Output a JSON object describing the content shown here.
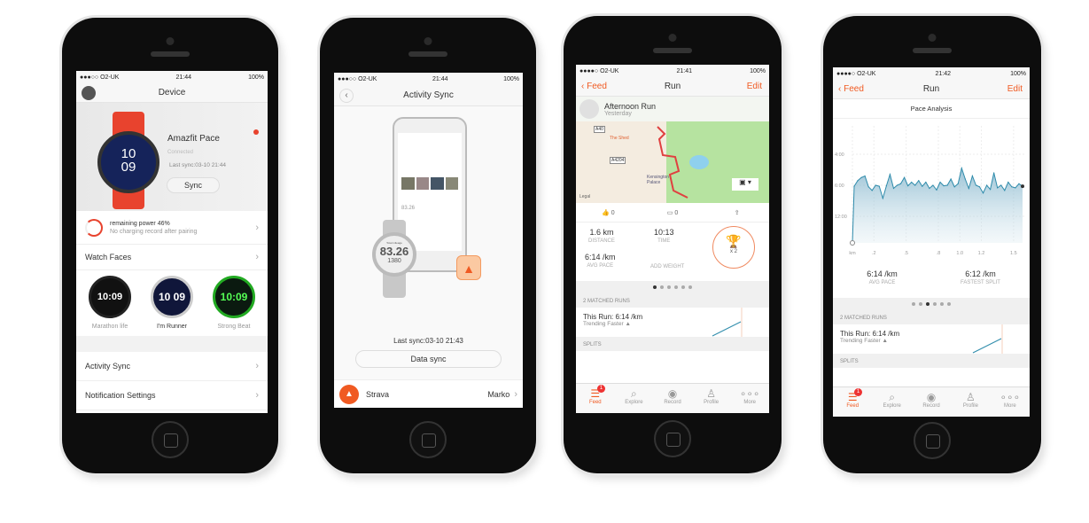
{
  "colors": {
    "strava_orange": "#f05a22",
    "amazfit_red": "#e8432e",
    "chart_line": "#2e8bab"
  },
  "phone1": {
    "status": {
      "carrier": "●●●○○ O2-UK",
      "time": "21:44",
      "battery": "100%"
    },
    "nav_title": "Device",
    "device": {
      "name": "Amazfit Pace",
      "state": "Connected",
      "last_sync": "Last sync:03-10 21:44",
      "sync_button": "Sync",
      "watch_hour": "10",
      "watch_min": "09"
    },
    "power": {
      "title": "remaining power 46%",
      "subtitle": "No charging record after pairing",
      "level_percent": 46
    },
    "watch_faces_label": "Watch Faces",
    "faces": [
      {
        "name": "Marathon life",
        "time": "10:09"
      },
      {
        "name": "I'm Runner",
        "time": "10 09"
      },
      {
        "name": "Strong Beat",
        "time": "10:09"
      }
    ],
    "menu": [
      "Activity Sync",
      "Notification Settings"
    ]
  },
  "phone2": {
    "status": {
      "carrier": "●●●○○ O2-UK",
      "time": "21:44",
      "battery": "100%"
    },
    "nav_title": "Activity Sync",
    "watch_label": "Total mileage",
    "watch_value": "83.26",
    "watch_sub": "1380",
    "phone_value": "83.26",
    "last_sync": "Last sync:03-10 21:43",
    "data_sync_button": "Data sync",
    "service": "Strava",
    "account": "Marko"
  },
  "phone3": {
    "status": {
      "carrier": "●●●●○ O2-UK",
      "time": "21:41",
      "battery": "100%"
    },
    "nav": {
      "back": "Feed",
      "title": "Run",
      "edit": "Edit"
    },
    "activity": {
      "title": "Afternoon Run",
      "when": "Yesterday"
    },
    "map": {
      "labels": [
        "A40",
        "The Shed",
        "A4204",
        "Kensington Palace",
        "Legal"
      ]
    },
    "social": {
      "kudos": "0",
      "comments": "0"
    },
    "stats": [
      {
        "value": "1.6 km",
        "label": "Distance"
      },
      {
        "value": "10:13",
        "label": "Time"
      },
      {
        "value": "6:14 /km",
        "label": "Avg Pace"
      },
      {
        "value": "",
        "label": "Add Weight"
      }
    ],
    "trophy": "x 2",
    "page_index": 0,
    "matched": {
      "header": "2 Matched Runs",
      "this_run": "This Run: 6:14 /km",
      "trend": "Trending Faster ▲"
    },
    "splits": "Splits",
    "tabs": [
      "Feed",
      "Explore",
      "Record",
      "Profile",
      "More"
    ],
    "badge": "1"
  },
  "phone4": {
    "status": {
      "carrier": "●●●●○ O2-UK",
      "time": "21:42",
      "battery": "100%"
    },
    "nav": {
      "back": "Feed",
      "title": "Run",
      "edit": "Edit"
    },
    "chart_title": "Pace Analysis",
    "chart_data": {
      "type": "area",
      "y_ticks": [
        "4:00",
        "6:00",
        "12:00"
      ],
      "x_ticks": [
        "km",
        ".2",
        ".5",
        ".8",
        "1.0",
        "1.2",
        "1.5"
      ],
      "xlim": [
        0,
        1.6
      ],
      "pace_min_per_km": [
        6.2,
        5.7,
        5.5,
        5.4,
        6.3,
        7.0,
        6.0,
        6.2,
        8.5,
        6.1,
        5.3,
        6.6,
        6.0,
        5.9,
        5.5,
        6.1,
        5.8,
        6.0,
        5.7,
        6.2,
        5.8,
        6.6,
        6.0,
        6.9,
        5.8,
        6.1,
        6.0,
        5.6,
        6.3,
        5.9,
        4.9,
        5.6,
        6.6,
        5.4,
        6.0,
        6.3,
        7.5,
        6.0,
        6.8,
        5.2,
        6.5,
        6.0,
        7.0,
        5.8,
        6.3,
        6.5,
        5.9,
        6.2
      ]
    },
    "stats": [
      {
        "value": "6:14 /km",
        "label": "Avg Pace"
      },
      {
        "value": "6:12 /km",
        "label": "Fastest Split"
      }
    ],
    "page_index": 2,
    "matched": {
      "header": "2 Matched Runs",
      "this_run": "This Run: 6:14 /km",
      "trend": "Trending Faster ▲"
    },
    "splits": "Splits",
    "tabs": [
      "Feed",
      "Explore",
      "Record",
      "Profile",
      "More"
    ],
    "badge": "1"
  }
}
